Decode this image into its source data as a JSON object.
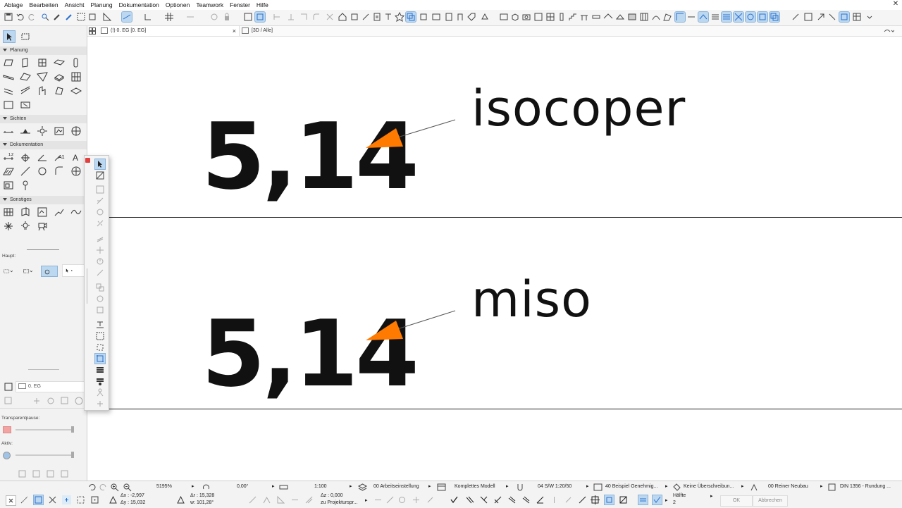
{
  "menu": [
    "Ablage",
    "Bearbeiten",
    "Ansicht",
    "Planung",
    "Dokumentation",
    "Optionen",
    "Teamwork",
    "Fenster",
    "Hilfe"
  ],
  "tabs": [
    {
      "label": "(!) 0. EG [0. EG]"
    },
    {
      "label": "[3D / Alle]"
    }
  ],
  "tab_close": "×",
  "palette": {
    "sections": [
      "Planung",
      "Sichten",
      "Dokumentation",
      "Sonstiges"
    ],
    "haupt_label": "Haupt:",
    "story_value": "0. EG",
    "transparent_label": "Transparentpause:",
    "aktiv_label": "Aktiv:"
  },
  "canvas": {
    "block1_number": "5,14",
    "block1_word": "isocoper",
    "block2_number": "5,14",
    "block2_word": "miso"
  },
  "colors": {
    "accent_arrow": "#ff7a00",
    "selected_tool_bg": "#bcd8f0"
  },
  "status": {
    "zoom": "5195%",
    "angle": "0,00°",
    "scale": "1:100",
    "layer_combo": "00 Arbeitseinstellung",
    "model_view": "Komplettes Modell",
    "pen_set": "04 S/W 1:20/50",
    "dimension_std": "40 Beispiel Genehmig...",
    "override": "Keine Überschreibun...",
    "renovation": "00 Reiner Neubau",
    "rounding": "DIN 1356 - Rundung ...",
    "dx": "Δx : -2,997",
    "dy": "Δy : 15,032",
    "r": "Δr : 15,328",
    "w": "w: 101,28°",
    "z": "Δz : 0,000",
    "proj": "zu Projekturspr...",
    "half_label": "Hälfte",
    "half_value": "2",
    "ok": "OK",
    "cancel": "Abbrechen"
  }
}
